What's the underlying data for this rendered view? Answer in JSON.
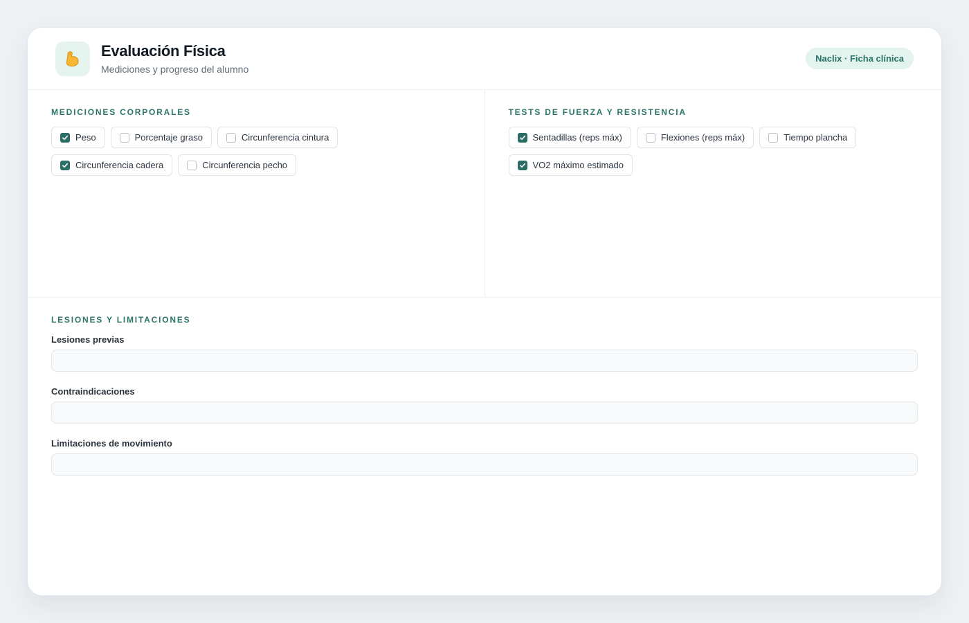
{
  "header": {
    "icon": "flexed-biceps-icon",
    "title": "Evaluación Física",
    "subtitle": "Mediciones y progreso del alumno",
    "badge": "Naclix · Ficha clínica"
  },
  "mediciones": {
    "title": "MEDICIONES CORPORALES",
    "options": [
      {
        "label": "Peso",
        "checked": true
      },
      {
        "label": "Porcentaje graso",
        "checked": false
      },
      {
        "label": "Circunferencia cintura",
        "checked": false
      },
      {
        "label": "Circunferencia cadera",
        "checked": true
      },
      {
        "label": "Circunferencia pecho",
        "checked": false
      }
    ]
  },
  "tests": {
    "title": "TESTS DE FUERZA Y RESISTENCIA",
    "options": [
      {
        "label": "Sentadillas (reps máx)",
        "checked": true
      },
      {
        "label": "Flexiones (reps máx)",
        "checked": false
      },
      {
        "label": "Tiempo plancha",
        "checked": false
      },
      {
        "label": "VO2 máximo estimado",
        "checked": true
      }
    ]
  },
  "lesiones": {
    "title": "LESIONES Y LIMITACIONES",
    "fields": [
      {
        "label": "Lesiones previas",
        "value": "",
        "placeholder": ""
      },
      {
        "label": "Contraindicaciones",
        "value": "",
        "placeholder": ""
      },
      {
        "label": "Limitaciones de movimiento",
        "value": "",
        "placeholder": ""
      }
    ]
  },
  "colors": {
    "accent": "#2b7569",
    "checkbox_checked": "#2c6e66",
    "badge_bg": "#e3f3ee"
  }
}
